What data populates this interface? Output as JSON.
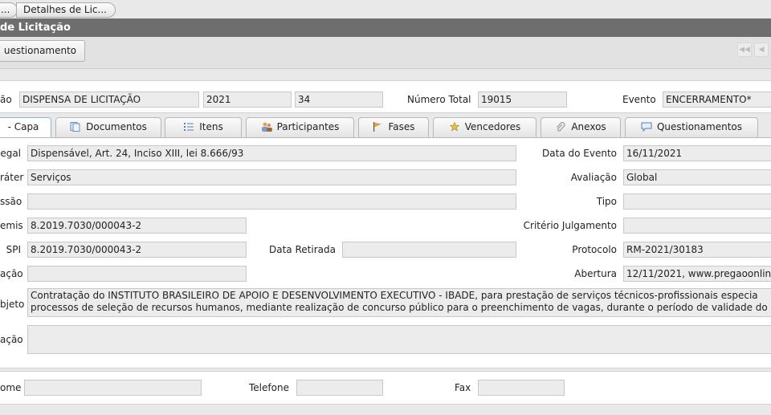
{
  "breadcrumbs": [
    "...",
    "Detalhes de Lic..."
  ],
  "window_title": "de Licitação",
  "toolbar": {
    "questionamento_label": "uestionamento"
  },
  "header": {
    "modalidade_label": "ão",
    "modalidade_value": "DISPENSA DE LICITAÇÃO",
    "ano_value": "2021",
    "numero_value": "34",
    "numero_total_label": "Número Total",
    "numero_total_value": "19015",
    "evento_label": "Evento",
    "evento_value": "ENCERRAMENTO*"
  },
  "tabs": [
    {
      "label": "- Capa",
      "icon": "cover-icon"
    },
    {
      "label": "Documentos",
      "icon": "documents-icon"
    },
    {
      "label": "Itens",
      "icon": "list-icon"
    },
    {
      "label": "Participantes",
      "icon": "participants-icon"
    },
    {
      "label": "Fases",
      "icon": "flag-icon"
    },
    {
      "label": "Vencedores",
      "icon": "medal-icon"
    },
    {
      "label": "Anexos",
      "icon": "paperclip-icon"
    },
    {
      "label": "Questionamentos",
      "icon": "speech-bubble-icon"
    }
  ],
  "capa": {
    "legal_label": "egal",
    "legal_value": "Dispensável, Art. 24, Inciso XIII, lei 8.666/93",
    "carater_label": "ráter",
    "carater_value": "Serviços",
    "sessao_label": "ssão",
    "sessao_value": "",
    "emis_label": "emis",
    "emis_value": "8.2019.7030/000043-2",
    "spi_label": "SPI",
    "spi_value": "8.2019.7030/000043-2",
    "data_retirada_label": "Data Retirada",
    "data_retirada_value": "",
    "acao_label": "ação",
    "acao_value": "",
    "objeto_label": "bjeto",
    "objeto_line1": "Contratação do INSTITUTO BRASILEIRO DE APOIO E DESENVOLVIMENTO EXECUTIVO - IBADE, para prestação de serviços técnicos-profissionais especia",
    "objeto_line2": "processos de seleção de recursos humanos, mediante realização de concurso público para o preenchimento de vagas, durante o período de validade do c",
    "observacao_label": "ação",
    "observacao_value": "",
    "data_evento_label": "Data do Evento",
    "data_evento_value": "16/11/2021",
    "avaliacao_label": "Avaliação",
    "avaliacao_value": "Global",
    "tipo_label": "Tipo",
    "tipo_value": "",
    "criterio_label": "Critério Julgamento",
    "criterio_value": "",
    "protocolo_label": "Protocolo",
    "protocolo_value": "RM-2021/30183",
    "abertura_label": "Abertura",
    "abertura_value": "12/11/2021, www.pregaoonlin"
  },
  "contato": {
    "nome_label": "ome",
    "nome_value": "",
    "telefone_label": "Telefone",
    "telefone_value": "",
    "fax_label": "Fax",
    "fax_value": ""
  }
}
